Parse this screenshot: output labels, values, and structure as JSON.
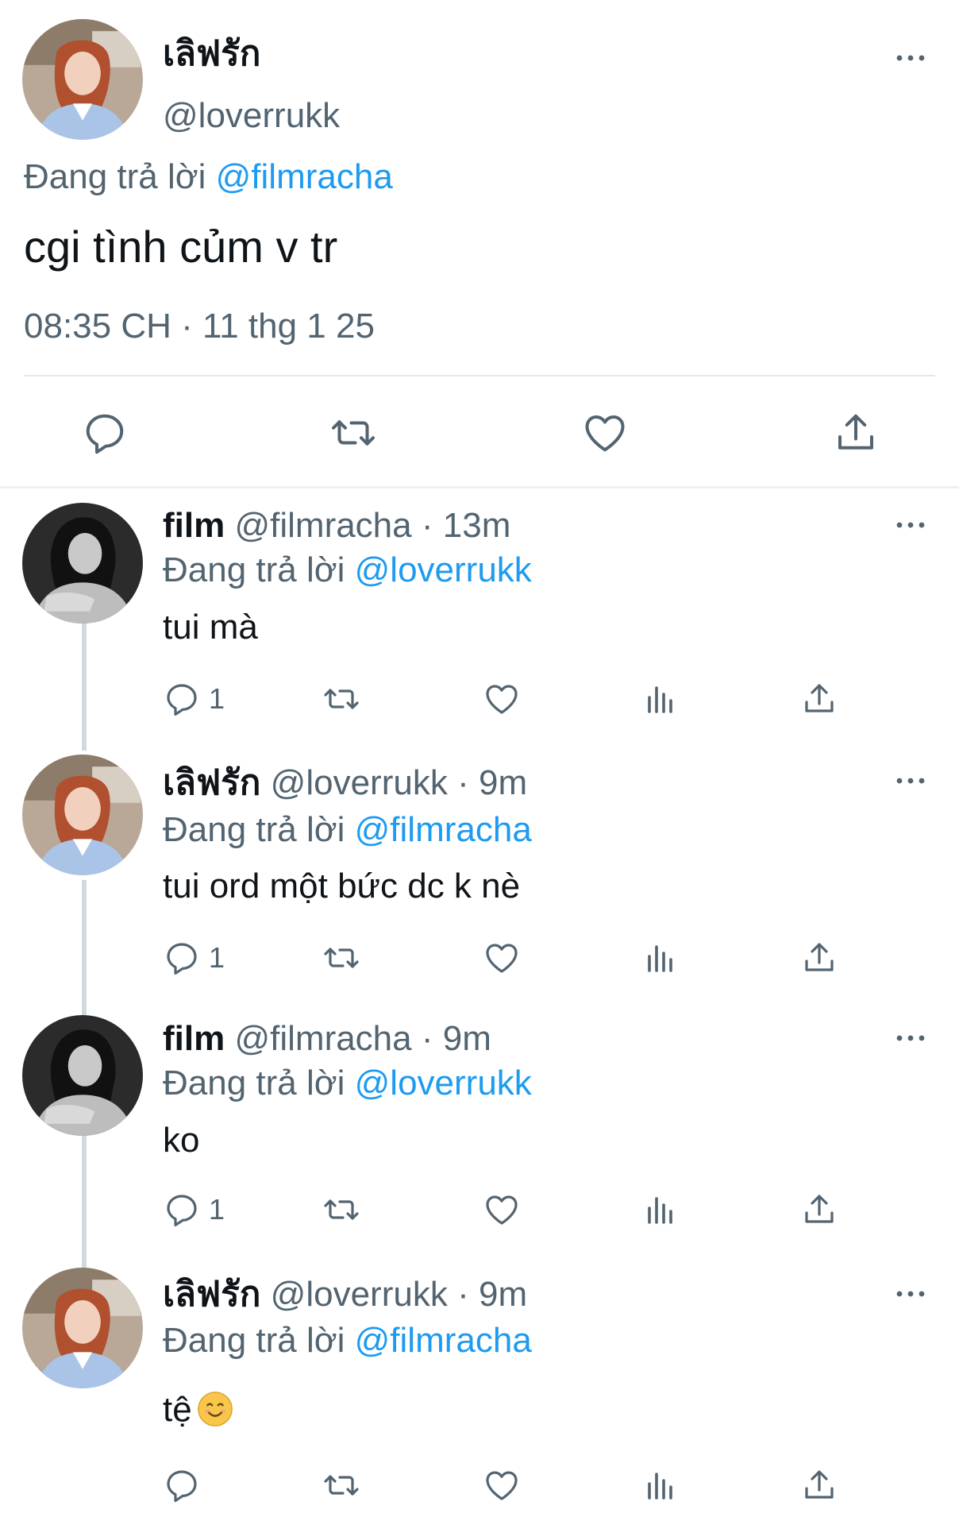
{
  "main_tweet": {
    "display_name": "เลิฟรัก",
    "handle": "@loverrukk",
    "replying_prefix": "Đang trả lời",
    "replying_to": "@filmracha",
    "text": "cgi tình củm v tr",
    "timestamp": "08:35 CH · 11 thg 1 25",
    "actions": {
      "reply": "reply-icon",
      "retweet": "retweet-icon",
      "like": "heart-icon",
      "share": "share-icon"
    }
  },
  "replies": [
    {
      "name": "film",
      "handle": "@filmracha",
      "time": "13m",
      "sep": "·",
      "replying_prefix": "Đang trả lời",
      "replying_to": "@loverrukk",
      "text": "tui mà",
      "reply_count": "1"
    },
    {
      "name": "เลิฟรัก",
      "handle": "@loverrukk",
      "time": "9m",
      "sep": "·",
      "replying_prefix": "Đang trả lời",
      "replying_to": "@filmracha",
      "text": "tui ord một bức dc k nè",
      "reply_count": "1"
    },
    {
      "name": "film",
      "handle": "@filmracha",
      "time": "9m",
      "sep": "·",
      "replying_prefix": "Đang trả lời",
      "replying_to": "@loverrukk",
      "text": "ko",
      "reply_count": "1"
    },
    {
      "name": "เลิฟรัก",
      "handle": "@loverrukk",
      "time": "9m",
      "sep": "·",
      "replying_prefix": "Đang trả lời",
      "replying_to": "@filmracha",
      "text": "tệ",
      "emoji": "smiling-face-emoji",
      "reply_count": ""
    }
  ],
  "colors": {
    "link": "#1d9bf0",
    "muted": "#536471",
    "text": "#0f1419",
    "thread_line": "#cfd9de"
  }
}
